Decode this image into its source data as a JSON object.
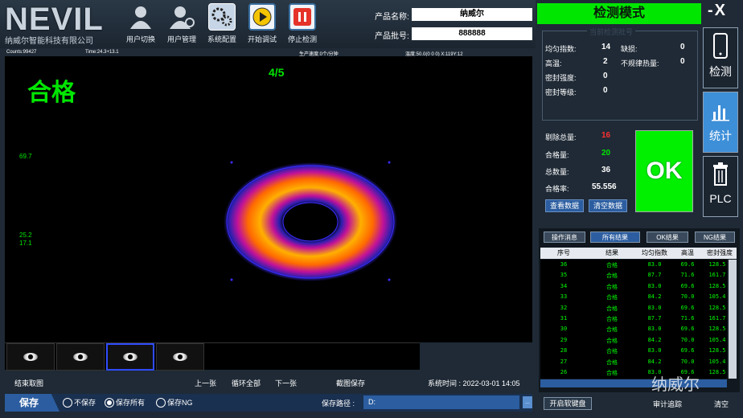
{
  "brand": {
    "logo": "NEVIL",
    "company": "纳威尔智能科技有限公司"
  },
  "toolbar": {
    "switch_user": "用户切换",
    "user_manage": "用户管理",
    "system_config": "系统配置",
    "start_debug": "开始调试",
    "stop_detect": "停止检测"
  },
  "product": {
    "name_label": "产品名称:",
    "name_value": "纳威尔",
    "batch_label": "产品批号:",
    "batch_value": "888888"
  },
  "mode": {
    "title": "检测模式",
    "window_controls": "-X"
  },
  "status": {
    "counts": "Counts:99427",
    "time": "Time:24.3+13.1",
    "speed": "生产速度:0个/分钟",
    "temp": "温度:50.0(0 0 0) X:119Y:12"
  },
  "view": {
    "verdict": "合格",
    "frame": "4/5",
    "scale_max": "69.7",
    "scale_mid": "25.2",
    "scale_min": "17.1",
    "colors": {
      "verdict": "#00e600",
      "ring_outer": "#2b1fb0",
      "ring_mid": "#c0119a",
      "ring_hot": "#ffb000"
    }
  },
  "nav": {
    "end_capture": "结束取图",
    "prev": "上一张",
    "loop_all": "循环全部",
    "next": "下一张",
    "screenshot_save": "截图保存",
    "system_time": "系统时间 : 2022-03-01 14:05"
  },
  "save": {
    "tab": "保存",
    "options": [
      "不保存",
      "保存所有",
      "保存NG"
    ],
    "selected": "保存所有",
    "path_label": "保存路径 :",
    "path_value": "D:",
    "browse": "..."
  },
  "current": {
    "title": "当前检测批号",
    "items": [
      {
        "label": "均匀指数:",
        "value": "14"
      },
      {
        "label": "高温:",
        "value": "2"
      },
      {
        "label": "密封强度:",
        "value": "0"
      },
      {
        "label": "密封等级:",
        "value": "0"
      }
    ],
    "items_right": [
      {
        "label": "缺损:",
        "value": "0"
      },
      {
        "label": "不规律热量:",
        "value": "0"
      }
    ]
  },
  "counters": {
    "reject_label": "剔除总量:",
    "reject_value": "16",
    "pass_label": "合格量:",
    "pass_value": "20",
    "total_label": "总数量:",
    "total_value": "36",
    "rate_label": "合格率:",
    "rate_value": "55.556",
    "view_data": "查看数据",
    "clear_data": "清空数据",
    "ok": "OK"
  },
  "side_nav": {
    "detect": "检测",
    "stats": "统计",
    "plc": "PLC",
    "active": "统计"
  },
  "results": {
    "tabs": [
      "操作消息",
      "所有结果",
      "OK结果",
      "NG结果"
    ],
    "active_tab": "所有结果",
    "columns": [
      "序号",
      "结果",
      "均匀指数",
      "高温",
      "密封强度"
    ],
    "rows": [
      [
        "36",
        "合格",
        "83.0",
        "69.6",
        "128.5"
      ],
      [
        "35",
        "合格",
        "87.7",
        "71.6",
        "161.7"
      ],
      [
        "34",
        "合格",
        "83.0",
        "69.6",
        "128.5"
      ],
      [
        "33",
        "合格",
        "84.2",
        "70.0",
        "105.4"
      ],
      [
        "32",
        "合格",
        "83.0",
        "69.6",
        "128.5"
      ],
      [
        "31",
        "合格",
        "87.7",
        "71.6",
        "161.7"
      ],
      [
        "30",
        "合格",
        "83.0",
        "69.6",
        "128.5"
      ],
      [
        "29",
        "合格",
        "84.2",
        "70.0",
        "105.4"
      ],
      [
        "28",
        "合格",
        "83.0",
        "69.6",
        "128.5"
      ],
      [
        "27",
        "合格",
        "84.2",
        "70.0",
        "105.4"
      ],
      [
        "26",
        "合格",
        "83.0",
        "69.6",
        "128.5"
      ]
    ]
  },
  "footer": {
    "keyboard": "开启软键盘",
    "audit": "审计追踪",
    "clear": "清空",
    "watermark": "纳威尔"
  }
}
